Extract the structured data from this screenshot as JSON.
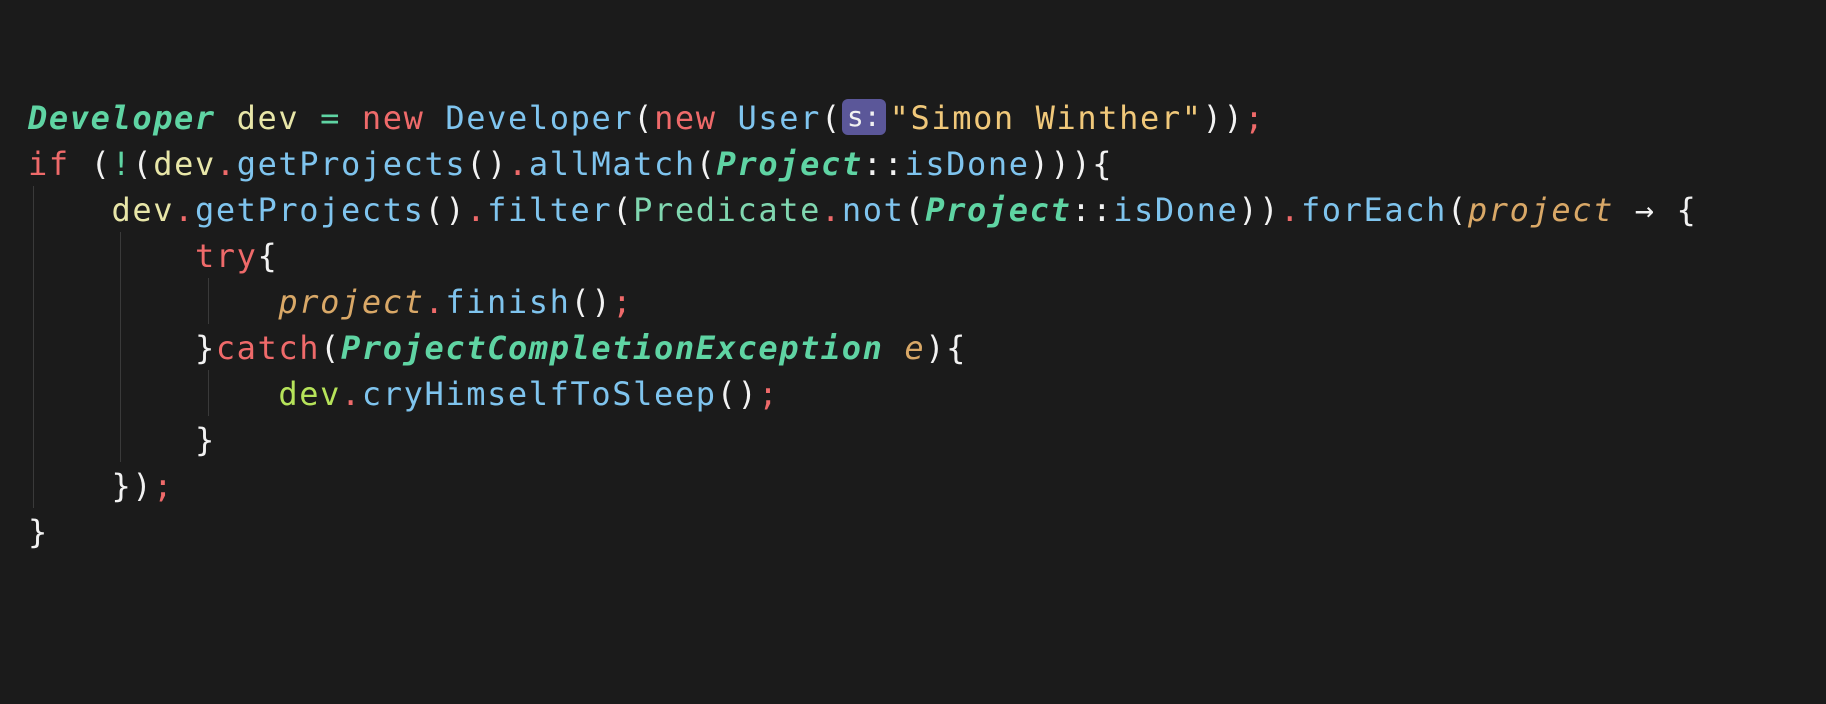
{
  "editor": {
    "background": "#1b1b1b",
    "lines": [
      {
        "tokens": [
          {
            "t": "Developer",
            "c": "tok-type"
          },
          {
            "t": " ",
            "c": "tok-plain"
          },
          {
            "t": "dev",
            "c": "tok-var"
          },
          {
            "t": " ",
            "c": "tok-plain"
          },
          {
            "t": "=",
            "c": "tok-op"
          },
          {
            "t": " ",
            "c": "tok-plain"
          },
          {
            "t": "new",
            "c": "tok-kw"
          },
          {
            "t": " ",
            "c": "tok-plain"
          },
          {
            "t": "Developer",
            "c": "tok-cls"
          },
          {
            "t": "(",
            "c": "tok-plain"
          },
          {
            "t": "new",
            "c": "tok-kw"
          },
          {
            "t": " ",
            "c": "tok-plain"
          },
          {
            "t": "User",
            "c": "tok-cls"
          },
          {
            "t": "(",
            "c": "tok-plain"
          },
          {
            "t": "s:",
            "c": "hint"
          },
          {
            "t": "\"Simon Winther\"",
            "c": "tok-str"
          },
          {
            "t": "))",
            "c": "tok-plain"
          },
          {
            "t": ";",
            "c": "tok-semi"
          }
        ]
      },
      {
        "tokens": [
          {
            "t": "if",
            "c": "tok-kw"
          },
          {
            "t": " (",
            "c": "tok-plain"
          },
          {
            "t": "!",
            "c": "tok-op"
          },
          {
            "t": "(",
            "c": "tok-plain"
          },
          {
            "t": "dev",
            "c": "tok-var"
          },
          {
            "t": ".",
            "c": "tok-dot"
          },
          {
            "t": "getProjects",
            "c": "tok-fn"
          },
          {
            "t": "()",
            "c": "tok-plain"
          },
          {
            "t": ".",
            "c": "tok-dot"
          },
          {
            "t": "allMatch",
            "c": "tok-fn"
          },
          {
            "t": "(",
            "c": "tok-plain"
          },
          {
            "t": "Project",
            "c": "tok-type"
          },
          {
            "t": "::",
            "c": "tok-plain"
          },
          {
            "t": "isDone",
            "c": "tok-fn"
          },
          {
            "t": "))){",
            "c": "tok-plain"
          }
        ]
      },
      {
        "tokens": [
          {
            "t": "    ",
            "c": "tok-plain"
          },
          {
            "t": "dev",
            "c": "tok-var"
          },
          {
            "t": ".",
            "c": "tok-dot"
          },
          {
            "t": "getProjects",
            "c": "tok-fn"
          },
          {
            "t": "()",
            "c": "tok-plain"
          },
          {
            "t": ".",
            "c": "tok-dot"
          },
          {
            "t": "filter",
            "c": "tok-fn"
          },
          {
            "t": "(",
            "c": "tok-plain"
          },
          {
            "t": "Predicate",
            "c": "tok-pred"
          },
          {
            "t": ".",
            "c": "tok-dot"
          },
          {
            "t": "not",
            "c": "tok-fn"
          },
          {
            "t": "(",
            "c": "tok-plain"
          },
          {
            "t": "Project",
            "c": "tok-type"
          },
          {
            "t": "::",
            "c": "tok-plain"
          },
          {
            "t": "isDone",
            "c": "tok-fn"
          },
          {
            "t": "))",
            "c": "tok-plain"
          },
          {
            "t": ".",
            "c": "tok-dot"
          },
          {
            "t": "forEach",
            "c": "tok-fn"
          },
          {
            "t": "(",
            "c": "tok-plain"
          },
          {
            "t": "project",
            "c": "tok-param"
          },
          {
            "t": " → {",
            "c": "tok-arrow"
          }
        ]
      },
      {
        "tokens": [
          {
            "t": "        ",
            "c": "tok-plain"
          },
          {
            "t": "try",
            "c": "tok-kw"
          },
          {
            "t": "{",
            "c": "tok-plain"
          }
        ]
      },
      {
        "tokens": [
          {
            "t": "            ",
            "c": "tok-plain"
          },
          {
            "t": "project",
            "c": "tok-param"
          },
          {
            "t": ".",
            "c": "tok-dot"
          },
          {
            "t": "finish",
            "c": "tok-fn"
          },
          {
            "t": "()",
            "c": "tok-plain"
          },
          {
            "t": ";",
            "c": "tok-semi"
          }
        ]
      },
      {
        "tokens": [
          {
            "t": "        ",
            "c": "tok-plain"
          },
          {
            "t": "}",
            "c": "tok-plain"
          },
          {
            "t": "catch",
            "c": "tok-kw"
          },
          {
            "t": "(",
            "c": "tok-plain"
          },
          {
            "t": "ProjectCompletionException",
            "c": "tok-type"
          },
          {
            "t": " ",
            "c": "tok-plain"
          },
          {
            "t": "e",
            "c": "tok-param"
          },
          {
            "t": "){",
            "c": "tok-plain"
          }
        ]
      },
      {
        "tokens": [
          {
            "t": "            ",
            "c": "tok-plain"
          },
          {
            "t": "dev",
            "c": "tok-dev"
          },
          {
            "t": ".",
            "c": "tok-dot"
          },
          {
            "t": "cryHimselfToSleep",
            "c": "tok-fn"
          },
          {
            "t": "()",
            "c": "tok-plain"
          },
          {
            "t": ";",
            "c": "tok-semi"
          }
        ]
      },
      {
        "tokens": [
          {
            "t": "        ",
            "c": "tok-plain"
          },
          {
            "t": "}",
            "c": "tok-plain"
          }
        ]
      },
      {
        "tokens": [
          {
            "t": "    ",
            "c": "tok-plain"
          },
          {
            "t": "})",
            "c": "tok-plain"
          },
          {
            "t": ";",
            "c": "tok-semi"
          }
        ]
      },
      {
        "tokens": [
          {
            "t": "}",
            "c": "tok-plain"
          }
        ]
      }
    ]
  }
}
